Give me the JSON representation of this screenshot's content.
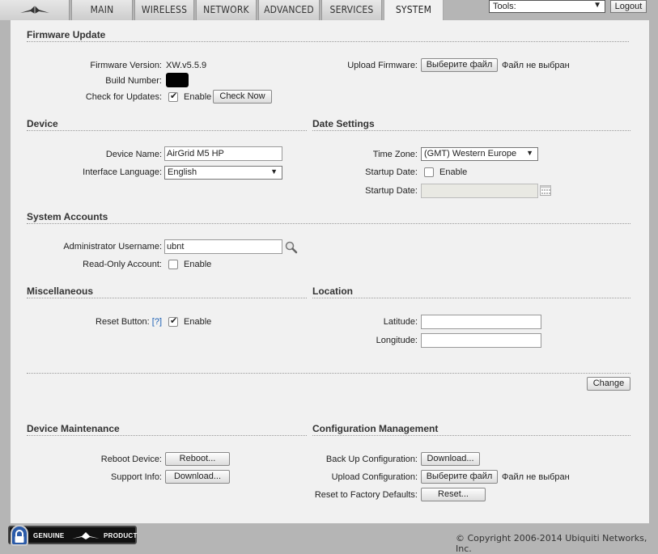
{
  "nav": {
    "tabs": [
      "MAIN",
      "WIRELESS",
      "NETWORK",
      "ADVANCED",
      "SERVICES",
      "SYSTEM"
    ],
    "active_tab": "SYSTEM",
    "tools_label": "Tools:",
    "logout_label": "Logout"
  },
  "firmware": {
    "title": "Firmware Update",
    "version_label": "Firmware Version:",
    "version_value": "XW.v5.5.9",
    "build_label": "Build Number:",
    "check_label": "Check for Updates:",
    "check_enable": "Enable",
    "check_now": "Check Now",
    "upload_label": "Upload Firmware:",
    "upload_button": "Выберите файл",
    "upload_status": "Файл не выбран"
  },
  "device": {
    "title": "Device",
    "name_label": "Device Name:",
    "name_value": "AirGrid M5 HP",
    "lang_label": "Interface Language:",
    "lang_value": "English"
  },
  "date": {
    "title": "Date Settings",
    "tz_label": "Time Zone:",
    "tz_value": "(GMT) Western Europe",
    "startup_label": "Startup Date:",
    "startup_enable": "Enable",
    "startup_date_label": "Startup Date:",
    "startup_date_value": ""
  },
  "accounts": {
    "title": "System Accounts",
    "admin_label": "Administrator Username:",
    "admin_value": "ubnt",
    "readonly_label": "Read-Only Account:",
    "readonly_enable": "Enable"
  },
  "misc": {
    "title": "Miscellaneous",
    "reset_label": "Reset Button:",
    "reset_help": "[?]",
    "reset_enable": "Enable"
  },
  "location": {
    "title": "Location",
    "lat_label": "Latitude:",
    "lat_value": "",
    "lon_label": "Longitude:",
    "lon_value": ""
  },
  "actions": {
    "change": "Change"
  },
  "maintenance": {
    "title": "Device Maintenance",
    "reboot_label": "Reboot Device:",
    "reboot_button": "Reboot...",
    "support_label": "Support Info:",
    "support_button": "Download..."
  },
  "config": {
    "title": "Configuration Management",
    "backup_label": "Back Up Configuration:",
    "backup_button": "Download...",
    "upload_label": "Upload Configuration:",
    "upload_button": "Выберите файл",
    "upload_status": "Файл не выбран",
    "reset_label": "Reset to Factory Defaults:",
    "reset_button": "Reset..."
  },
  "footer": {
    "badge_left": "GENUINE",
    "badge_right": "PRODUCT",
    "copyright": "© Copyright 2006-2014 Ubiquiti Networks, Inc."
  },
  "icons": {
    "logo": "ubiquiti-logo-icon",
    "search": "magnifier-icon",
    "calendar": "calendar-icon",
    "lock": "lock-icon"
  }
}
